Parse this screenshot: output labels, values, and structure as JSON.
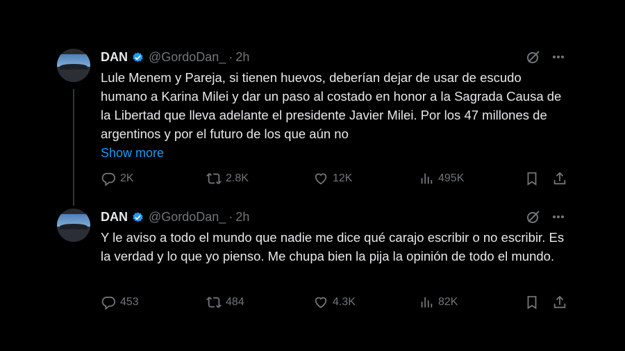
{
  "colors": {
    "background": "#000000",
    "text": "#e7e9ea",
    "muted": "#71767b",
    "link": "#1d9bf0",
    "verified": "#1d9bf0"
  },
  "tweets": [
    {
      "name": "DAN",
      "handle": "@GordoDan_",
      "separator": "·",
      "time": "2h",
      "text": "Lule Menem y Pareja, si tienen huevos, deberían dejar de usar de escudo humano a Karina Milei y dar un paso al costado en honor a la Sagrada Causa de la Libertad que lleva adelante el presidente Javier Milei. Por los 47 millones de argentinos y por el futuro de los que aún no",
      "show_more": "Show more",
      "replies": "2K",
      "retweets": "2.8K",
      "likes": "12K",
      "views": "495K"
    },
    {
      "name": "DAN",
      "handle": "@GordoDan_",
      "separator": "·",
      "time": "2h",
      "text": "Y le aviso a todo el mundo que nadie me dice qué carajo escribir o no escribir. Es la verdad y lo que yo pienso. Me chupa bien la pija la opinión de todo el mundo.",
      "replies": "453",
      "retweets": "484",
      "likes": "4.3K",
      "views": "82K"
    }
  ],
  "icons": [
    "verified-badge-icon",
    "grok-icon",
    "more-icon",
    "reply-icon",
    "retweet-icon",
    "like-icon",
    "views-icon",
    "bookmark-icon",
    "share-icon"
  ]
}
